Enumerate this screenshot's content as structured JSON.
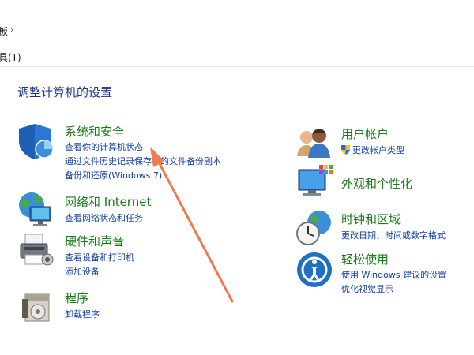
{
  "address": {
    "crumb": "板",
    "sep": "›"
  },
  "menu": {
    "tools_prefix": "具(",
    "tools_key": "T",
    "tools_suffix": ")"
  },
  "page_title": "调整计算机的设置",
  "left": [
    {
      "title": "系统和安全",
      "links": [
        "查看你的计算机状态",
        "通过文件历史记录保存你的文件备份副本",
        "备份和还原(Windows 7)"
      ]
    },
    {
      "title": "网络和 Internet",
      "links": [
        "查看网络状态和任务"
      ]
    },
    {
      "title": "硬件和声音",
      "links": [
        "查看设备和打印机",
        "添加设备"
      ]
    },
    {
      "title": "程序",
      "links": [
        "卸载程序"
      ]
    }
  ],
  "right": [
    {
      "title": "用户帐户",
      "links": [
        "更改帐户类型"
      ]
    },
    {
      "title": "外观和个性化",
      "links": []
    },
    {
      "title": "时钟和区域",
      "links": [
        "更改日期、时间或数字格式"
      ]
    },
    {
      "title": "轻松使用",
      "links": [
        "使用 Windows 建议的设置",
        "优化视觉显示"
      ]
    }
  ],
  "colors": {
    "title_green": "#1a7d1a",
    "link_blue": "#0f3ea8",
    "heading_blue": "#1e3287",
    "annotation_arrow": "#ee7b4f"
  },
  "icons": {
    "system_security": "shield-icon",
    "network": "globe-monitor-icon",
    "hardware": "printer-icon",
    "programs": "program-box-icon",
    "user_accounts": "users-icon",
    "appearance": "monitor-palette-icon",
    "clock_region": "clock-globe-icon",
    "ease_of_access": "ease-of-access-icon"
  }
}
